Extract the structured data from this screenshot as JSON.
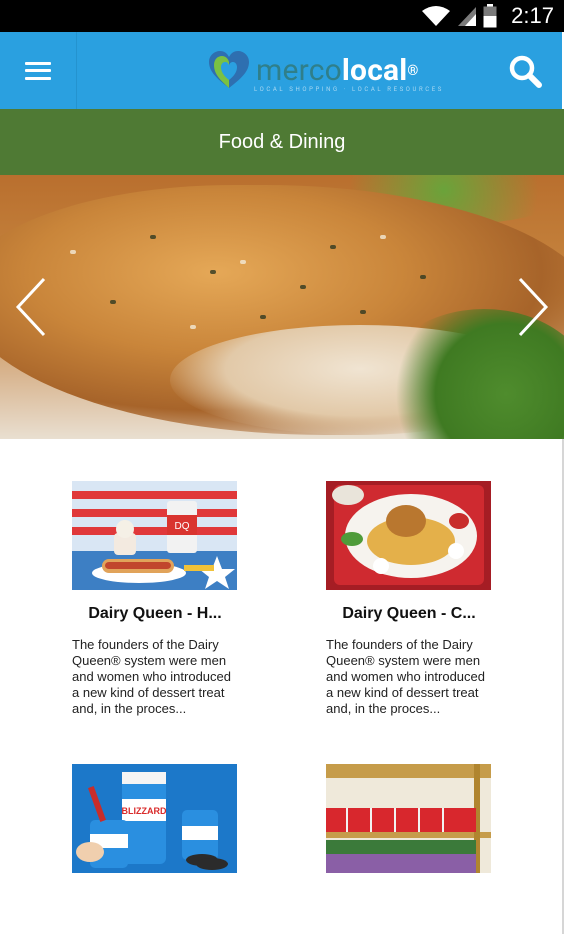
{
  "status_bar": {
    "time": "2:17"
  },
  "app_bar": {
    "logo": {
      "part1": "merco",
      "part2": "local",
      "mark": "®",
      "tagline": "LOCAL SHOPPING · LOCAL RESOURCES"
    }
  },
  "category": {
    "title": "Food & Dining"
  },
  "listings": [
    {
      "title": "Dairy Queen - H...",
      "description": "The founders of the Dairy Queen® system were men and women who introduced a new kind of dessert treat and, in the proces..."
    },
    {
      "title": "Dairy Queen - C...",
      "description": "The founders of the Dairy Queen® system were men and women who introduced a new kind of dessert treat and, in the proces..."
    }
  ],
  "colors": {
    "primary": "#2aa0e0",
    "category_band": "#4f7a34",
    "status_bar": "#000000"
  },
  "icons": {
    "menu": "hamburger-icon",
    "search": "search-icon",
    "prev": "chevron-left-icon",
    "next": "chevron-right-icon",
    "wifi": "wifi-icon",
    "signal": "cell-signal-icon",
    "battery": "battery-icon"
  }
}
